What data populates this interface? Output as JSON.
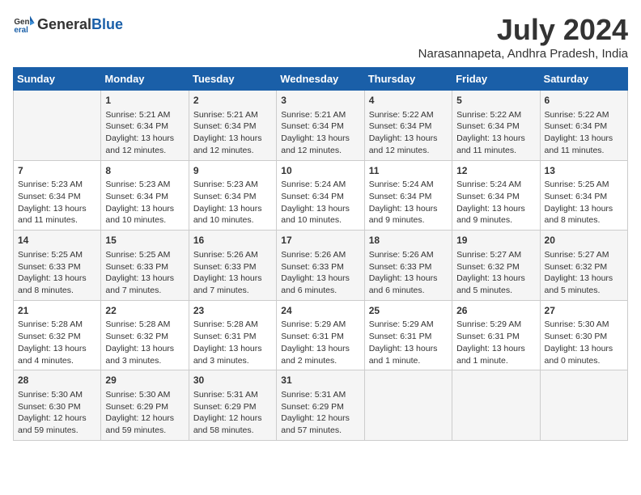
{
  "logo": {
    "general": "General",
    "blue": "Blue"
  },
  "title": "July 2024",
  "location": "Narasannapeta, Andhra Pradesh, India",
  "weekdays": [
    "Sunday",
    "Monday",
    "Tuesday",
    "Wednesday",
    "Thursday",
    "Friday",
    "Saturday"
  ],
  "weeks": [
    [
      {
        "day": "",
        "info": ""
      },
      {
        "day": "1",
        "info": "Sunrise: 5:21 AM\nSunset: 6:34 PM\nDaylight: 13 hours\nand 12 minutes."
      },
      {
        "day": "2",
        "info": "Sunrise: 5:21 AM\nSunset: 6:34 PM\nDaylight: 13 hours\nand 12 minutes."
      },
      {
        "day": "3",
        "info": "Sunrise: 5:21 AM\nSunset: 6:34 PM\nDaylight: 13 hours\nand 12 minutes."
      },
      {
        "day": "4",
        "info": "Sunrise: 5:22 AM\nSunset: 6:34 PM\nDaylight: 13 hours\nand 12 minutes."
      },
      {
        "day": "5",
        "info": "Sunrise: 5:22 AM\nSunset: 6:34 PM\nDaylight: 13 hours\nand 11 minutes."
      },
      {
        "day": "6",
        "info": "Sunrise: 5:22 AM\nSunset: 6:34 PM\nDaylight: 13 hours\nand 11 minutes."
      }
    ],
    [
      {
        "day": "7",
        "info": "Sunrise: 5:23 AM\nSunset: 6:34 PM\nDaylight: 13 hours\nand 11 minutes."
      },
      {
        "day": "8",
        "info": "Sunrise: 5:23 AM\nSunset: 6:34 PM\nDaylight: 13 hours\nand 10 minutes."
      },
      {
        "day": "9",
        "info": "Sunrise: 5:23 AM\nSunset: 6:34 PM\nDaylight: 13 hours\nand 10 minutes."
      },
      {
        "day": "10",
        "info": "Sunrise: 5:24 AM\nSunset: 6:34 PM\nDaylight: 13 hours\nand 10 minutes."
      },
      {
        "day": "11",
        "info": "Sunrise: 5:24 AM\nSunset: 6:34 PM\nDaylight: 13 hours\nand 9 minutes."
      },
      {
        "day": "12",
        "info": "Sunrise: 5:24 AM\nSunset: 6:34 PM\nDaylight: 13 hours\nand 9 minutes."
      },
      {
        "day": "13",
        "info": "Sunrise: 5:25 AM\nSunset: 6:34 PM\nDaylight: 13 hours\nand 8 minutes."
      }
    ],
    [
      {
        "day": "14",
        "info": "Sunrise: 5:25 AM\nSunset: 6:33 PM\nDaylight: 13 hours\nand 8 minutes."
      },
      {
        "day": "15",
        "info": "Sunrise: 5:25 AM\nSunset: 6:33 PM\nDaylight: 13 hours\nand 7 minutes."
      },
      {
        "day": "16",
        "info": "Sunrise: 5:26 AM\nSunset: 6:33 PM\nDaylight: 13 hours\nand 7 minutes."
      },
      {
        "day": "17",
        "info": "Sunrise: 5:26 AM\nSunset: 6:33 PM\nDaylight: 13 hours\nand 6 minutes."
      },
      {
        "day": "18",
        "info": "Sunrise: 5:26 AM\nSunset: 6:33 PM\nDaylight: 13 hours\nand 6 minutes."
      },
      {
        "day": "19",
        "info": "Sunrise: 5:27 AM\nSunset: 6:32 PM\nDaylight: 13 hours\nand 5 minutes."
      },
      {
        "day": "20",
        "info": "Sunrise: 5:27 AM\nSunset: 6:32 PM\nDaylight: 13 hours\nand 5 minutes."
      }
    ],
    [
      {
        "day": "21",
        "info": "Sunrise: 5:28 AM\nSunset: 6:32 PM\nDaylight: 13 hours\nand 4 minutes."
      },
      {
        "day": "22",
        "info": "Sunrise: 5:28 AM\nSunset: 6:32 PM\nDaylight: 13 hours\nand 3 minutes."
      },
      {
        "day": "23",
        "info": "Sunrise: 5:28 AM\nSunset: 6:31 PM\nDaylight: 13 hours\nand 3 minutes."
      },
      {
        "day": "24",
        "info": "Sunrise: 5:29 AM\nSunset: 6:31 PM\nDaylight: 13 hours\nand 2 minutes."
      },
      {
        "day": "25",
        "info": "Sunrise: 5:29 AM\nSunset: 6:31 PM\nDaylight: 13 hours\nand 1 minute."
      },
      {
        "day": "26",
        "info": "Sunrise: 5:29 AM\nSunset: 6:31 PM\nDaylight: 13 hours\nand 1 minute."
      },
      {
        "day": "27",
        "info": "Sunrise: 5:30 AM\nSunset: 6:30 PM\nDaylight: 13 hours\nand 0 minutes."
      }
    ],
    [
      {
        "day": "28",
        "info": "Sunrise: 5:30 AM\nSunset: 6:30 PM\nDaylight: 12 hours\nand 59 minutes."
      },
      {
        "day": "29",
        "info": "Sunrise: 5:30 AM\nSunset: 6:29 PM\nDaylight: 12 hours\nand 59 minutes."
      },
      {
        "day": "30",
        "info": "Sunrise: 5:31 AM\nSunset: 6:29 PM\nDaylight: 12 hours\nand 58 minutes."
      },
      {
        "day": "31",
        "info": "Sunrise: 5:31 AM\nSunset: 6:29 PM\nDaylight: 12 hours\nand 57 minutes."
      },
      {
        "day": "",
        "info": ""
      },
      {
        "day": "",
        "info": ""
      },
      {
        "day": "",
        "info": ""
      }
    ]
  ]
}
